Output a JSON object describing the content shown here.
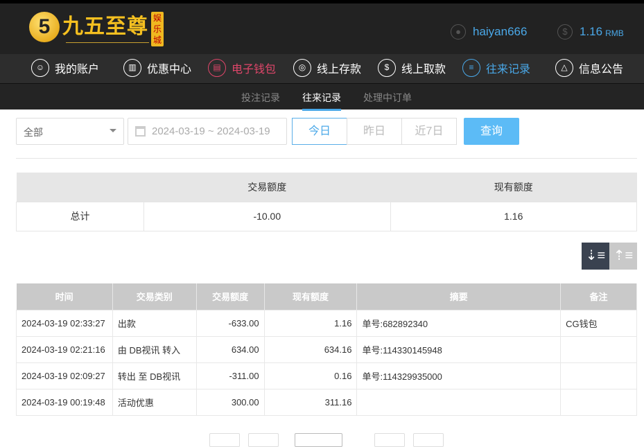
{
  "header": {
    "logo_text": "九五至尊",
    "logo_mark": "5",
    "logo_tag": "娱乐城",
    "username": "haiyan666",
    "balance": "1.16",
    "currency": "RMB"
  },
  "nav": [
    {
      "label": "我的账户",
      "icon": "user-icon"
    },
    {
      "label": "优惠中心",
      "icon": "gift-icon"
    },
    {
      "label": "电子钱包",
      "icon": "wallet-icon"
    },
    {
      "label": "线上存款",
      "icon": "deposit-icon"
    },
    {
      "label": "线上取款",
      "icon": "withdraw-icon"
    },
    {
      "label": "往来记录",
      "icon": "records-icon"
    },
    {
      "label": "信息公告",
      "icon": "bell-icon"
    }
  ],
  "subnav": [
    "投注记录",
    "往来记录",
    "处理中订单"
  ],
  "filters": {
    "type": "全部",
    "date_range": "2024-03-19 ~ 2024-03-19",
    "quick": [
      "今日",
      "昨日",
      "近7日"
    ],
    "query": "查询"
  },
  "summary": {
    "headers": [
      "",
      "交易额度",
      "现有额度"
    ],
    "row": [
      "总计",
      "-10.00",
      "1.16"
    ]
  },
  "table": {
    "headers": [
      "时间",
      "交易类别",
      "交易额度",
      "现有额度",
      "摘要",
      "备注"
    ],
    "rows": [
      [
        "2024-03-19 02:33:27",
        "出款",
        "-633.00",
        "1.16",
        "单号:682892340",
        "CG钱包"
      ],
      [
        "2024-03-19 02:21:16",
        "由 DB视讯 转入",
        "634.00",
        "634.16",
        "单号:114330145948",
        ""
      ],
      [
        "2024-03-19 02:09:27",
        "转出 至 DB视讯",
        "-311.00",
        "0.16",
        "单号:114329935000",
        ""
      ],
      [
        "2024-03-19 00:19:48",
        "活动优惠",
        "300.00",
        "311.16",
        "",
        ""
      ]
    ]
  }
}
